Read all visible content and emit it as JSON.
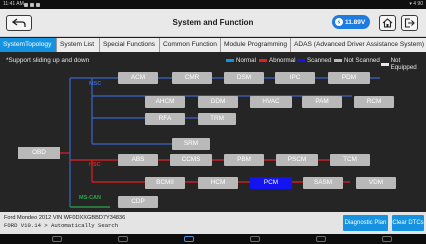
{
  "status_bar": {
    "time": "11:41 AM",
    "battery": "▾ 4 90"
  },
  "header": {
    "title": "System and Function",
    "voltage": "11.89V"
  },
  "tabs": [
    {
      "label": "SystemTopology",
      "active": true
    },
    {
      "label": "System List",
      "active": false
    },
    {
      "label": "Special Functions",
      "active": false
    },
    {
      "label": "Common Function",
      "active": false
    },
    {
      "label": "Module Programming",
      "active": false
    },
    {
      "label": "ADAS (Advanced Driver Assistance System)",
      "active": false
    }
  ],
  "topology": {
    "note": "*Support sliding up and down",
    "legend": [
      {
        "label": "Normal",
        "color": "#1693e0"
      },
      {
        "label": "Abnormal",
        "color": "#e02020"
      },
      {
        "label": "Scanned",
        "color": "#1414f0"
      },
      {
        "label": "Not Scanned",
        "color": "#b9b9b9"
      },
      {
        "label": "Not Equipped",
        "color": "#e8e8e8"
      }
    ],
    "gateway": "OBD",
    "buses": [
      {
        "name": "MSC",
        "color": "#3a66c8"
      },
      {
        "name": "HSC",
        "color": "#e02020"
      },
      {
        "name": "MS-CAN",
        "color": "#2aa84a"
      }
    ],
    "ecus": {
      "acm": "ACM",
      "cmr": "CMR",
      "dsm": "DSM",
      "ipc": "IPC",
      "pdm": "PDM",
      "ahcm": "AHCM",
      "ddm": "DDM",
      "hvac": "HVAC",
      "pam": "PAM",
      "rcm": "RCM",
      "rfa": "RFA",
      "trm": "TRM",
      "srm": "SRM",
      "abs": "ABS",
      "ccms": "CCMS",
      "pbm": "PBM",
      "pscm": "PSCM",
      "tcm": "TCM",
      "bcmii": "BCMII",
      "hcm": "HCM",
      "pcm": "PCM",
      "sasm": "SASM",
      "vdm": "VDM",
      "cdp": "CDP"
    }
  },
  "footer": {
    "vehicle_line1": "Ford  Mondeo  2012  VIN  WF0DXXGBBD7Y34836",
    "vehicle_line2": "FORD V10.14 > Automatically Search",
    "diagnostic_plan": "Diagnostic Plan",
    "clear_dtcs": "Clear DTCs"
  }
}
